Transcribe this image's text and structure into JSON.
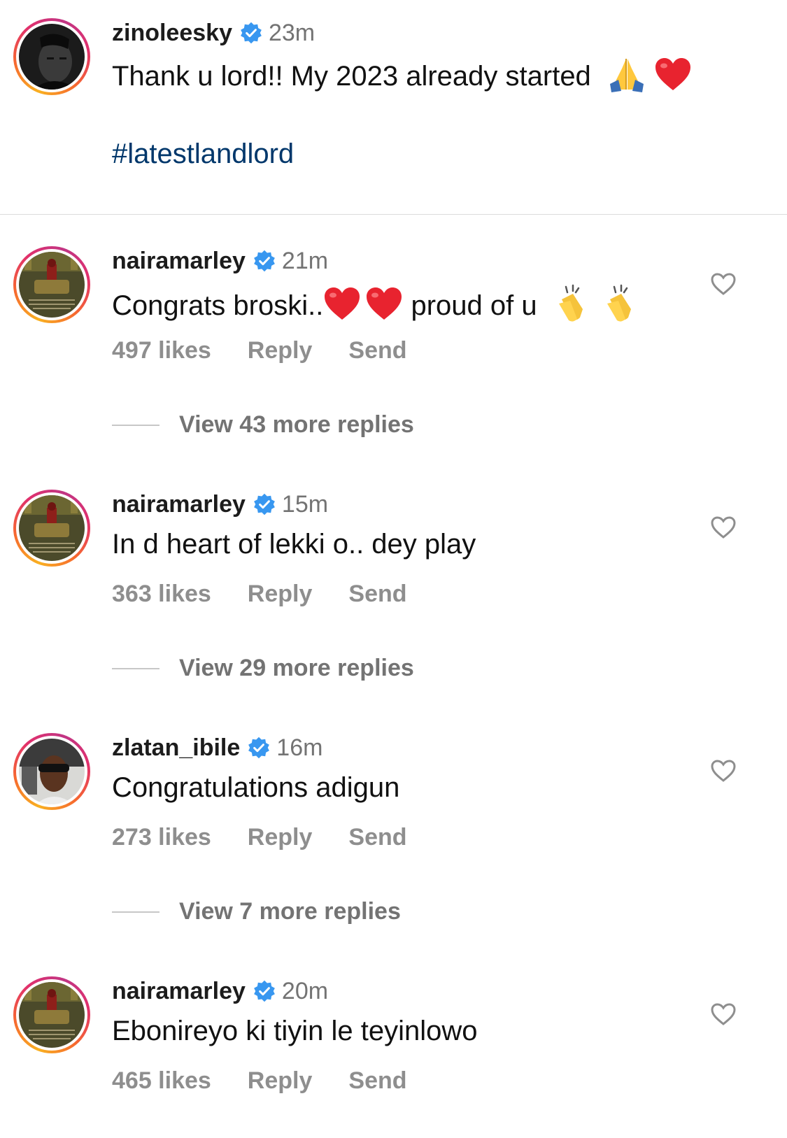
{
  "caption": {
    "username": "zinoleesky",
    "time": "23m",
    "text": "Thank u lord!! My 2023 already started",
    "emojis": [
      "folded-hands",
      "red-heart"
    ],
    "hashtag": "#latestlandlord"
  },
  "comments": [
    {
      "username": "nairamarley",
      "time": "21m",
      "text_before": "Congrats broski..",
      "text_after": " proud of u",
      "likes": "497 likes",
      "reply": "Reply",
      "send": "Send",
      "view_replies": "View 43 more replies"
    },
    {
      "username": "nairamarley",
      "time": "15m",
      "text": "In d heart of lekki o.. dey play",
      "likes": "363 likes",
      "reply": "Reply",
      "send": "Send",
      "view_replies": "View 29 more replies"
    },
    {
      "username": "zlatan_ibile",
      "time": "16m",
      "text": "Congratulations adigun",
      "likes": "273 likes",
      "reply": "Reply",
      "send": "Send",
      "view_replies": "View 7 more replies"
    },
    {
      "username": "nairamarley",
      "time": "20m",
      "text": "Ebonireyo ki tiyin le teyinlowo",
      "likes": "465 likes",
      "reply": "Reply",
      "send": "Send"
    }
  ],
  "colors": {
    "verified": "#3897f0",
    "hashtag": "#00376b",
    "muted": "#8e8e8e"
  }
}
